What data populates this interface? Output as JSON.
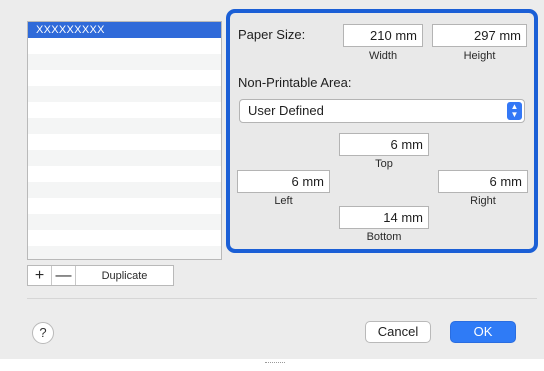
{
  "list": {
    "selected_item": "XXXXXXXXX",
    "row_count": 15
  },
  "list_controls": {
    "add": "+",
    "remove": "—",
    "duplicate": "Duplicate"
  },
  "panel": {
    "paper_size_label": "Paper Size:",
    "width_value": "210 mm",
    "width_caption": "Width",
    "height_value": "297 mm",
    "height_caption": "Height",
    "non_printable_label": "Non-Printable Area:",
    "area_select": "User Defined",
    "top_value": "6 mm",
    "top_caption": "Top",
    "left_value": "6 mm",
    "left_caption": "Left",
    "right_value": "6 mm",
    "right_caption": "Right",
    "bottom_value": "14 mm",
    "bottom_caption": "Bottom"
  },
  "footer": {
    "help": "?",
    "cancel": "Cancel",
    "ok": "OK"
  },
  "colors": {
    "highlight_border": "#1b5fd6",
    "selection": "#2f6ad9",
    "ok_button": "#2f7bf6"
  },
  "icons": {
    "select_arrow": "chevron-updown-icon"
  }
}
